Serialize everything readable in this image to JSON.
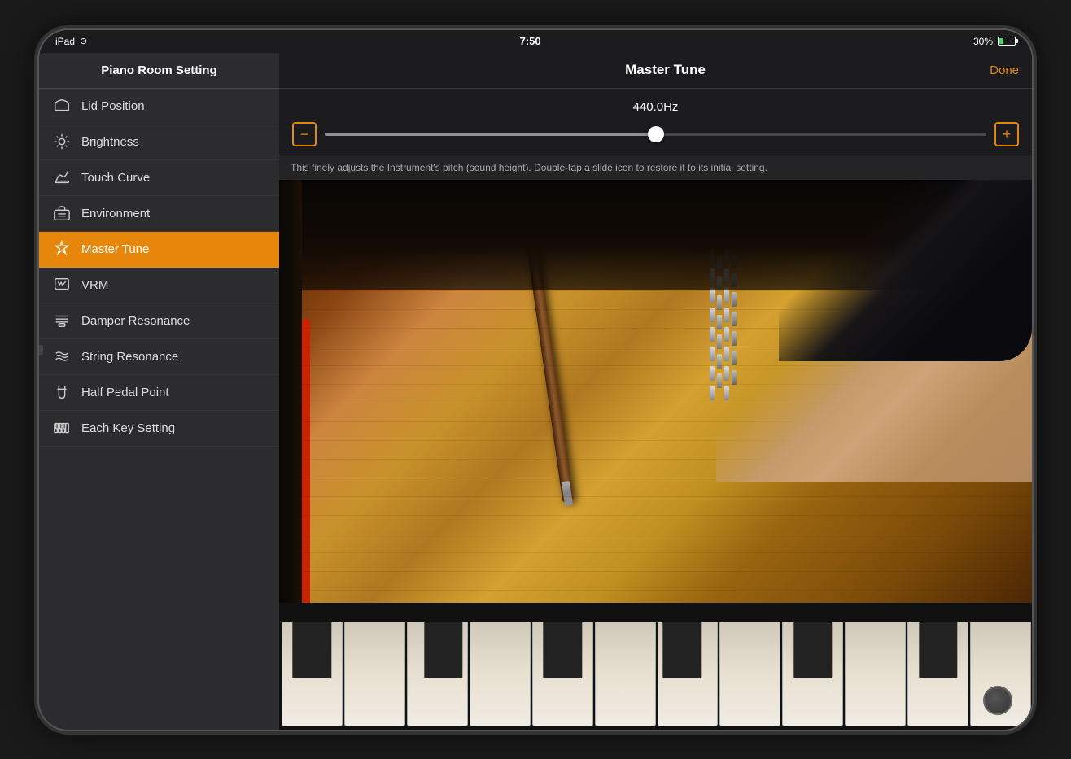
{
  "device": {
    "status_bar": {
      "left": "iPad",
      "time": "7:50",
      "battery_percent": "30%"
    }
  },
  "sidebar": {
    "title": "Piano Room Setting",
    "items": [
      {
        "id": "lid-position",
        "label": "Lid Position",
        "icon": "lid"
      },
      {
        "id": "brightness",
        "label": "Brightness",
        "icon": "brightness"
      },
      {
        "id": "touch-curve",
        "label": "Touch Curve",
        "icon": "touch-curve"
      },
      {
        "id": "environment",
        "label": "Environment",
        "icon": "environment"
      },
      {
        "id": "master-tune",
        "label": "Master Tune",
        "icon": "master-tune",
        "active": true
      },
      {
        "id": "vrm",
        "label": "VRM",
        "icon": "vrm"
      },
      {
        "id": "damper-resonance",
        "label": "Damper Resonance",
        "icon": "damper"
      },
      {
        "id": "string-resonance",
        "label": "String Resonance",
        "icon": "string"
      },
      {
        "id": "half-pedal",
        "label": "Half Pedal Point",
        "icon": "pedal"
      },
      {
        "id": "each-key",
        "label": "Each Key Setting",
        "icon": "key"
      }
    ]
  },
  "main": {
    "title": "Master Tune",
    "done_label": "Done",
    "tune_hz": "440.0Hz",
    "description": "This finely adjusts the Instrument's pitch (sound height). Double-tap a slide icon to restore it to its initial setting.",
    "slider_value": 50,
    "minus_label": "−",
    "plus_label": "+"
  },
  "colors": {
    "accent": "#e6860a",
    "active_bg": "#e6860a",
    "sidebar_bg": "#2c2c2e",
    "main_bg": "#1c1c1e"
  }
}
